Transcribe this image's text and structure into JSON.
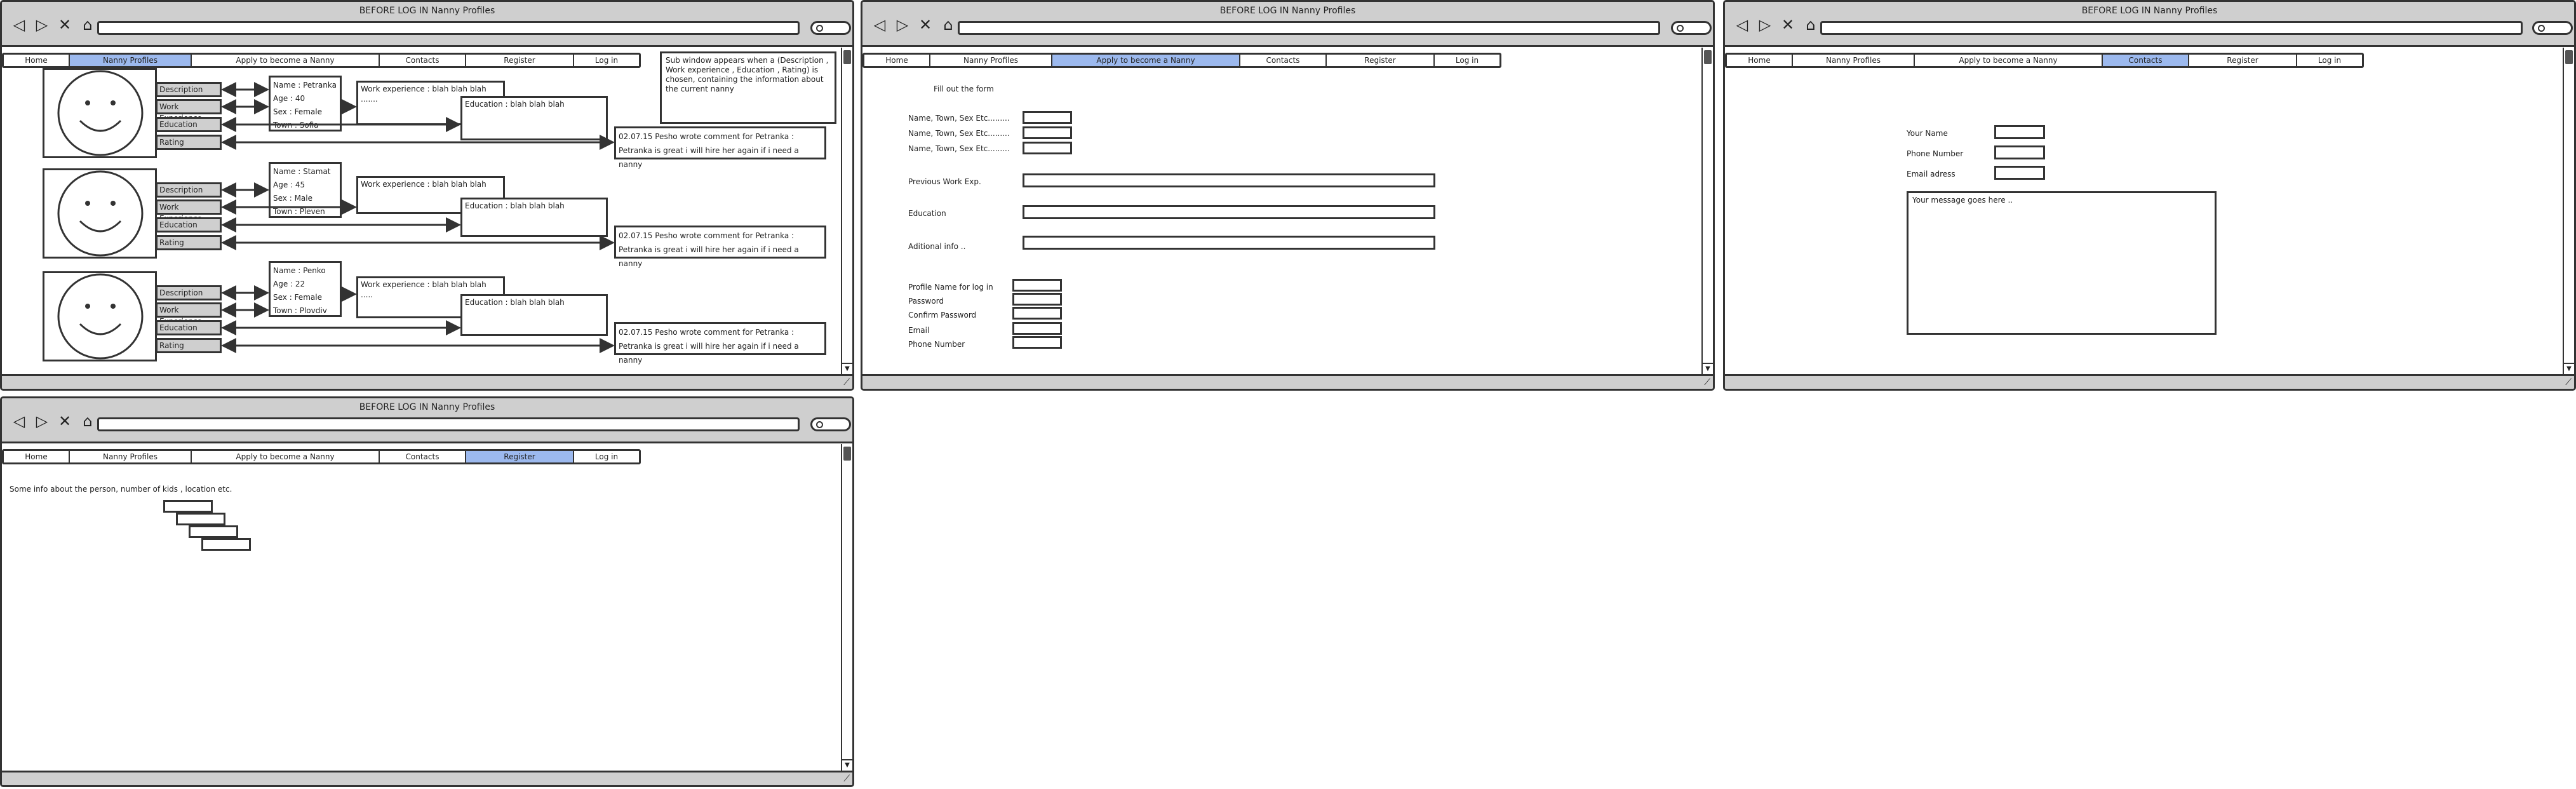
{
  "browser": {
    "title": "BEFORE LOG IN Nanny Profiles",
    "nav_icons": {
      "back": "◁",
      "forward": "▷",
      "stop": "✕",
      "home": "⌂"
    }
  },
  "nav": {
    "home": "Home",
    "nanny_profiles": "Nanny Profiles",
    "apply": "Apply to become a Nanny",
    "contacts": "Contacts",
    "register": "Register",
    "login": "Log in"
  },
  "colors": {
    "active_tab": "#9cb9ee",
    "chrome": "#cfcfcf"
  },
  "profiles_window": {
    "side_buttons": [
      "Description",
      "Work Experience",
      "Education",
      "Rating"
    ],
    "note": "Sub window appears when a (Description , Work experience , Education , Rating) is chosen, containing the information about the current nanny",
    "profiles": [
      {
        "name": "Name : Petranka",
        "age": "Age : 40",
        "sex": "Sex : Female",
        "town": "Town : Sofia",
        "work": "Work experience : blah blah blah .......",
        "education": "Education : blah blah blah",
        "comment_head": "02.07.15 Pesho wrote comment for Petranka :",
        "comment_body": "Petranka is great i will hire her again if i need a nanny"
      },
      {
        "name": "Name : Stamat",
        "age": "Age : 45",
        "sex": "Sex : Male",
        "town": "Town : Pleven",
        "work": "Work experience : blah blah blah",
        "education": "Education : blah blah blah",
        "comment_head": "02.07.15 Pesho wrote comment for Petranka :",
        "comment_body": "Petranka is great i will hire her again if i need a nanny"
      },
      {
        "name": "Name : Penko",
        "age": "Age : 22",
        "sex": "Sex : Female",
        "town": "Town : Plovdiv",
        "work": "Work experience : blah blah blah .....",
        "education": "Education : blah blah blah",
        "comment_head": "02.07.15 Pesho wrote comment for Petranka :",
        "comment_body": "Petranka is great i will hire her again if i need a nanny"
      }
    ]
  },
  "apply_window": {
    "heading": "Fill out the form",
    "row_labels": [
      "Name, Town, Sex Etc.........",
      "Name, Town, Sex Etc.........",
      "Name, Town, Sex Etc........."
    ],
    "previous_work": "Previous Work Exp.",
    "education": "Education",
    "additional": "Aditional info ..",
    "account_labels": [
      "Profile Name for log in",
      "Password",
      "Confirm Password",
      "Email",
      "Phone Number"
    ]
  },
  "contacts_window": {
    "your_name": "Your Name",
    "phone": "Phone Number",
    "email": "Email adress",
    "message_placeholder": "Your message goes here .."
  },
  "register_window": {
    "info": "Some info about the person, number of kids , location etc."
  }
}
